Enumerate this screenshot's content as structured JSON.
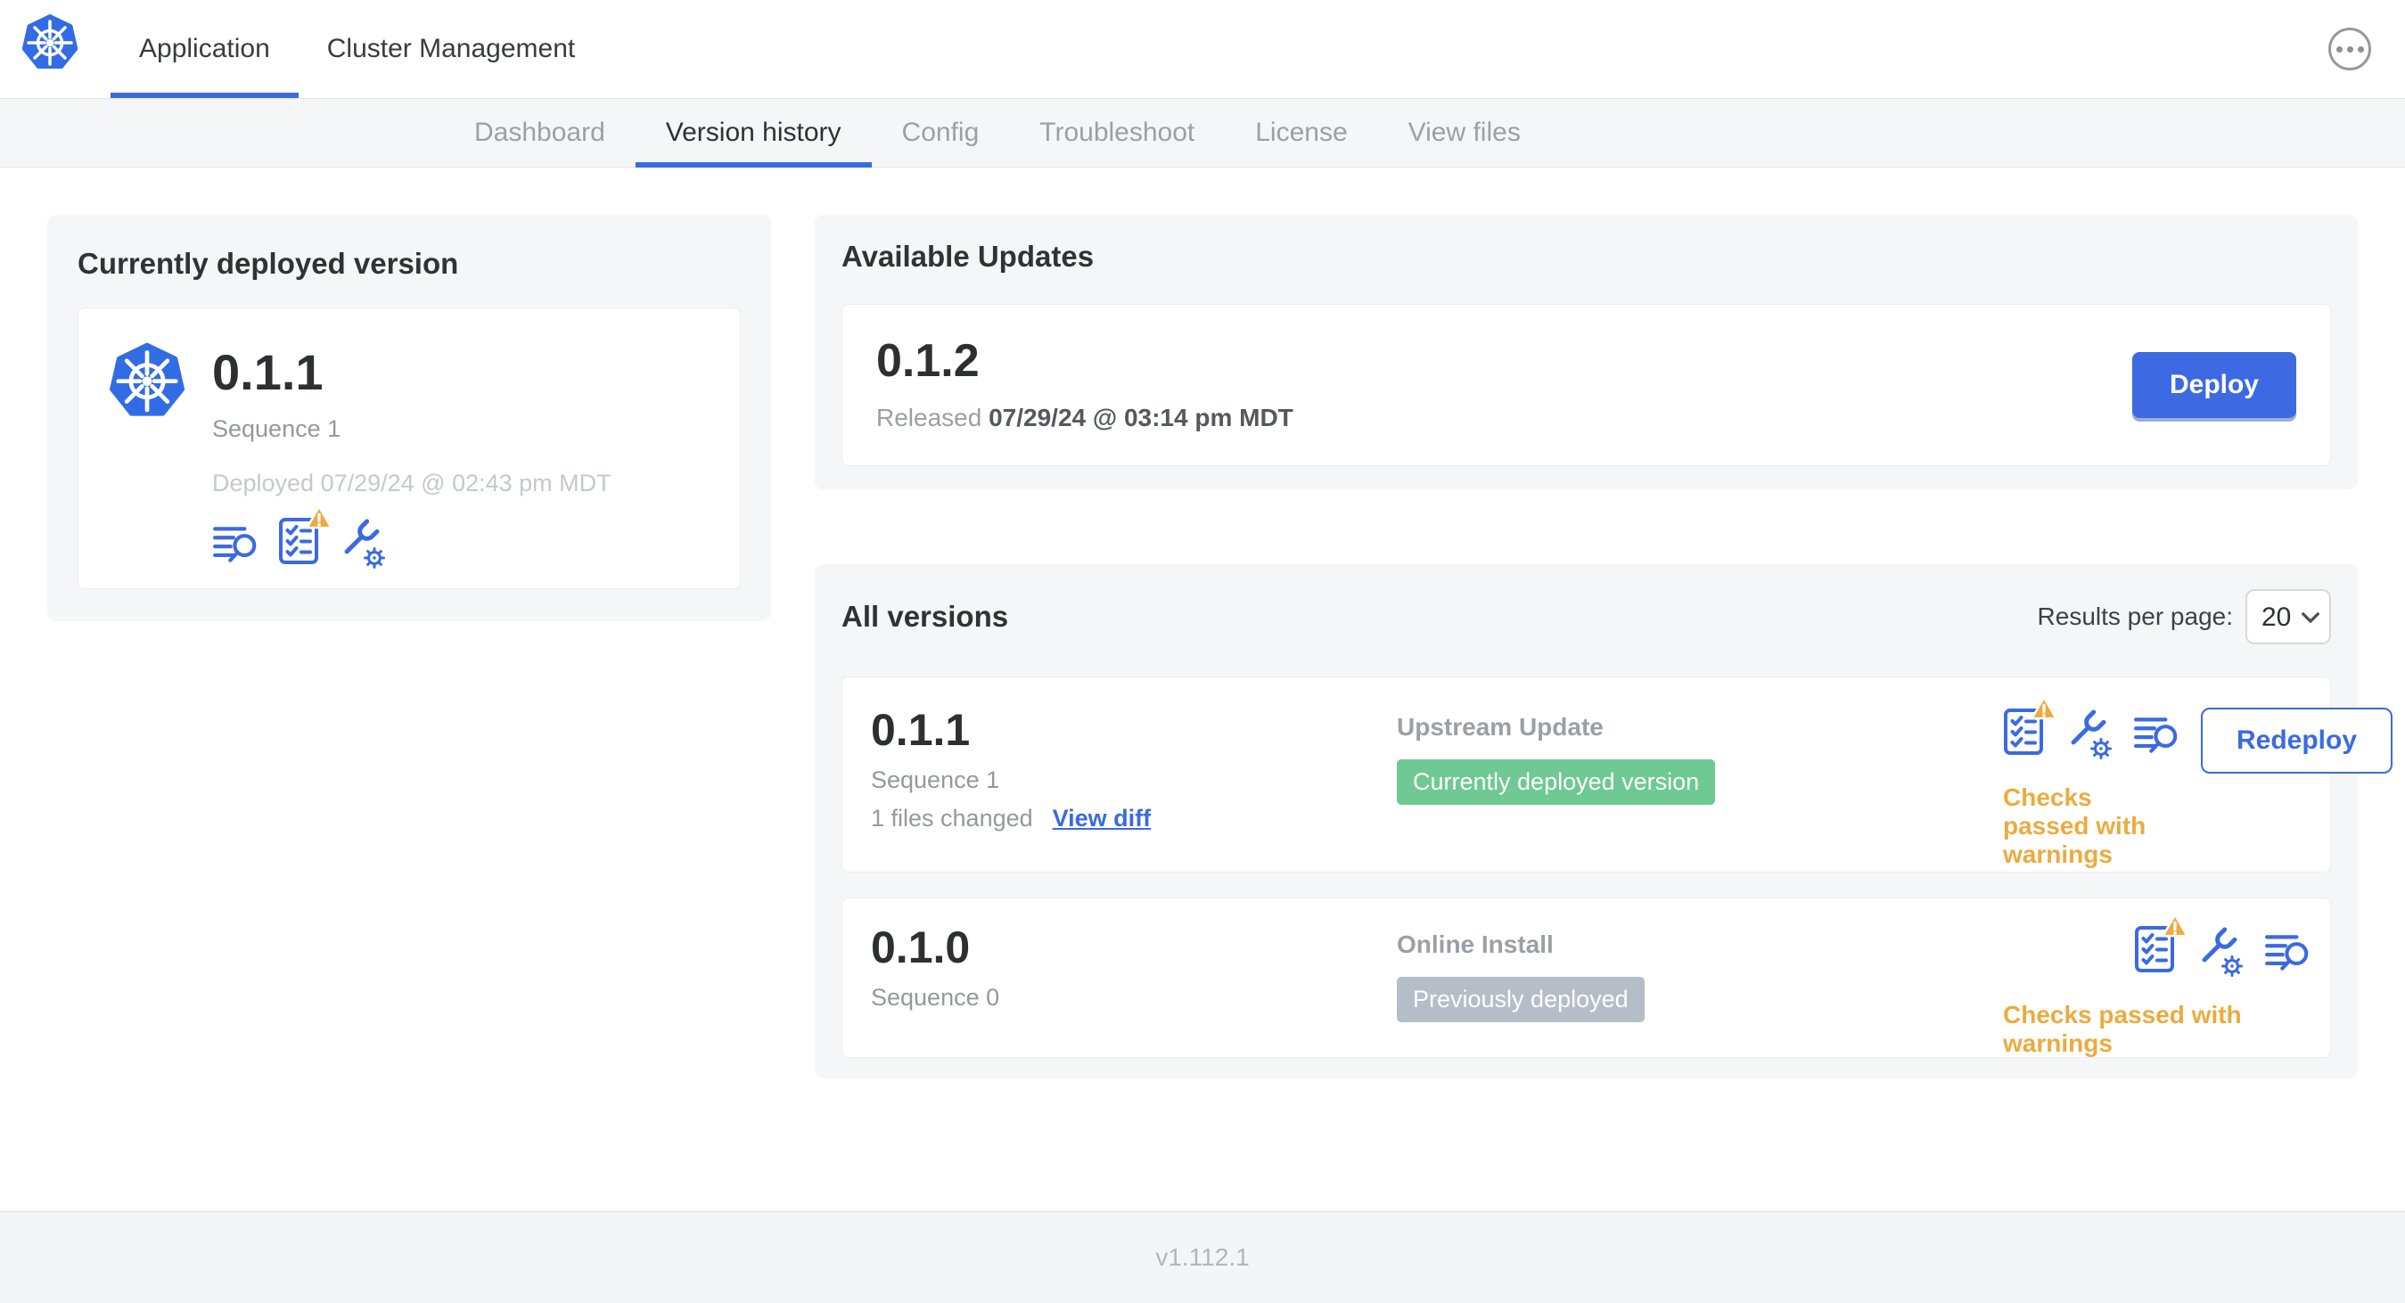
{
  "header": {
    "app_tab": "Application",
    "cluster_tab": "Cluster Management"
  },
  "subnav": {
    "tabs": [
      "Dashboard",
      "Version history",
      "Config",
      "Troubleshoot",
      "License",
      "View files"
    ],
    "active_tab": "Version history"
  },
  "current": {
    "title": "Currently deployed version",
    "version": "0.1.1",
    "sequence": "Sequence 1",
    "deployed": "Deployed 07/29/24 @ 02:43 pm MDT"
  },
  "updates": {
    "title": "Available Updates",
    "version": "0.1.2",
    "released_prefix": "Released",
    "released_date": "07/29/24 @ 03:14 pm MDT",
    "deploy_label": "Deploy"
  },
  "versions": {
    "title": "All versions",
    "results_label": "Results per page:",
    "results_value": "20",
    "rows": [
      {
        "version": "0.1.1",
        "sequence": "Sequence 1",
        "files_changed": "1 files changed",
        "view_diff_label": "View diff",
        "source": "Upstream Update",
        "badge": "Currently deployed version",
        "status": "Checks passed with warnings",
        "action_label": "Redeploy"
      },
      {
        "version": "0.1.0",
        "sequence": "Sequence 0",
        "source": "Online Install",
        "badge": "Previously deployed",
        "status": "Checks passed with warnings"
      }
    ]
  },
  "footer": {
    "app_version": "v1.112.1"
  },
  "icons": {
    "brand": "kubernetes-logo",
    "logs": "lines-magnifier",
    "preflight": "checklist-with-warning",
    "config": "wrench-gear",
    "overflow": "ellipsis-in-circle",
    "select_chevron": "chevron-down"
  },
  "colors": {
    "primary_blue": "#3b6ae1",
    "k8s_blue": "#326CE5",
    "badge_green": "#6fc992",
    "badge_gray": "#b5bec8",
    "warning_amber": "#ecab3f",
    "card_gray": "#f5f6f8"
  }
}
